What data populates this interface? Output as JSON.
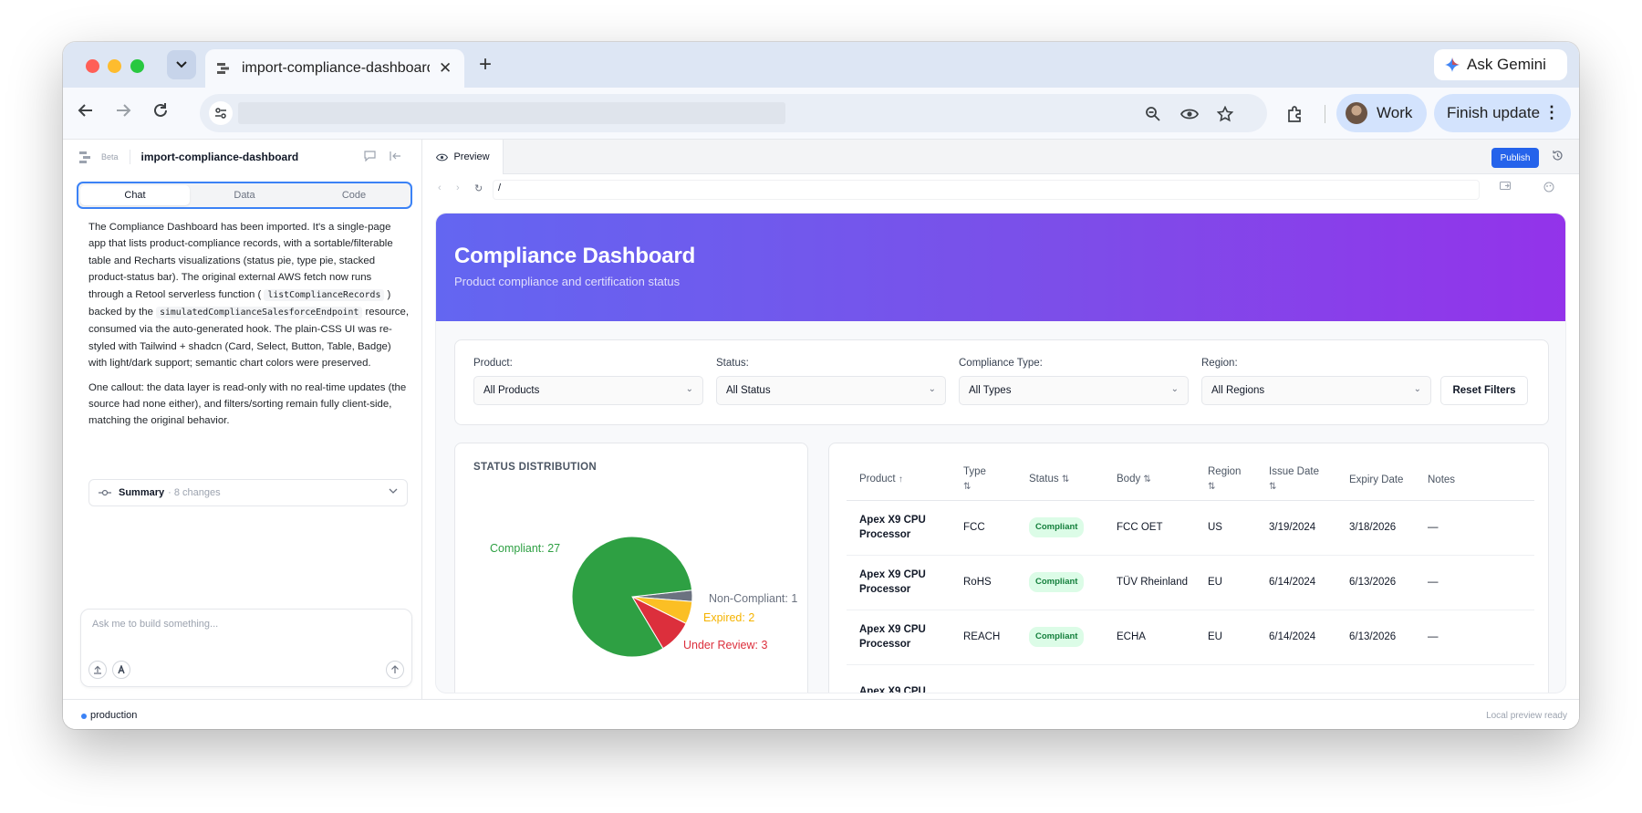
{
  "browser": {
    "tab_title": "import-compliance-dashboard",
    "gemini_label": "Ask Gemini",
    "profile_label": "Work",
    "finish_update_label": "Finish update"
  },
  "left_panel": {
    "beta_label": "Beta",
    "project_name": "import-compliance-dashboard",
    "tabs": [
      "Chat",
      "Data",
      "Code"
    ],
    "message": {
      "p1_a": "The Compliance Dashboard has been imported. It's a single-page app that lists product-compliance records, with a sortable/filterable table and Recharts visualizations (status pie, type pie, stacked product-status bar). The original external AWS fetch now runs through a Retool serverless function (",
      "p1_code1": "listComplianceRecords",
      "p1_b": ") backed by the",
      "p1_code2": "simulatedComplianceSalesforceEndpoint",
      "p1_c": "resource, consumed via the auto-generated hook. The plain-CSS UI was re-styled with Tailwind + shadcn (Card, Select, Button, Table, Badge) with light/dark support; semantic chart colors were preserved.",
      "p2": "One callout: the data layer is read-only with no real-time updates (the source had none either), and filters/sorting remain fully client-side, matching the original behavior."
    },
    "summary_label": "Summary",
    "summary_count": "· 8 changes",
    "composer_placeholder": "Ask me to build something..."
  },
  "right_panel": {
    "preview_tab": "Preview",
    "publish_label": "Publish",
    "address_path": "/"
  },
  "dashboard": {
    "title": "Compliance Dashboard",
    "subtitle": "Product compliance and certification status",
    "filters": [
      {
        "label": "Product:",
        "value": "All Products"
      },
      {
        "label": "Status:",
        "value": "All Status"
      },
      {
        "label": "Compliance Type:",
        "value": "All Types"
      },
      {
        "label": "Region:",
        "value": "All Regions"
      }
    ],
    "reset_label": "Reset Filters",
    "table": {
      "headers": [
        "Product ↑",
        "Type ⇅",
        "Status ⇅",
        "Body ⇅",
        "Region ⇅",
        "Issue Date ⇅",
        "Expiry Date",
        "Notes"
      ],
      "header_names": [
        "Product",
        "Type",
        "Status",
        "Body",
        "Region",
        "Issue Date",
        "Expiry Date",
        "Notes"
      ],
      "header_sorts": [
        "↑",
        "⇅",
        "⇅",
        "⇅",
        "⇅",
        "⇅",
        "",
        ""
      ],
      "rows": [
        [
          "Apex X9 CPU Processor",
          "FCC",
          "Compliant",
          "FCC OET",
          "US",
          "3/19/2024",
          "3/18/2026",
          "—"
        ],
        [
          "Apex X9 CPU Processor",
          "RoHS",
          "Compliant",
          "TÜV Rheinland",
          "EU",
          "6/14/2024",
          "6/13/2026",
          "—"
        ],
        [
          "Apex X9 CPU Processor",
          "REACH",
          "Compliant",
          "ECHA",
          "EU",
          "6/14/2024",
          "6/13/2026",
          "—"
        ],
        [
          "Apex X9 CPU",
          "",
          "",
          "",
          "",
          "",
          "",
          ""
        ]
      ]
    }
  },
  "chart_data": {
    "type": "pie",
    "title": "STATUS DISTRIBUTION",
    "slices": [
      {
        "label": "Compliant: 27",
        "name": "Compliant",
        "value": 27,
        "color": "#2ea043"
      },
      {
        "label": "Non-Compliant: 1",
        "name": "Non-Compliant",
        "value": 1,
        "color": "#6b7280"
      },
      {
        "label": "Expired: 2",
        "name": "Expired",
        "value": 2,
        "color": "#fbbf24"
      },
      {
        "label": "Under Review: 3",
        "name": "Under Review",
        "value": 3,
        "color": "#dc2f3c"
      }
    ]
  },
  "status_bar": {
    "environment": "production",
    "preview_status": "Local preview ready"
  }
}
